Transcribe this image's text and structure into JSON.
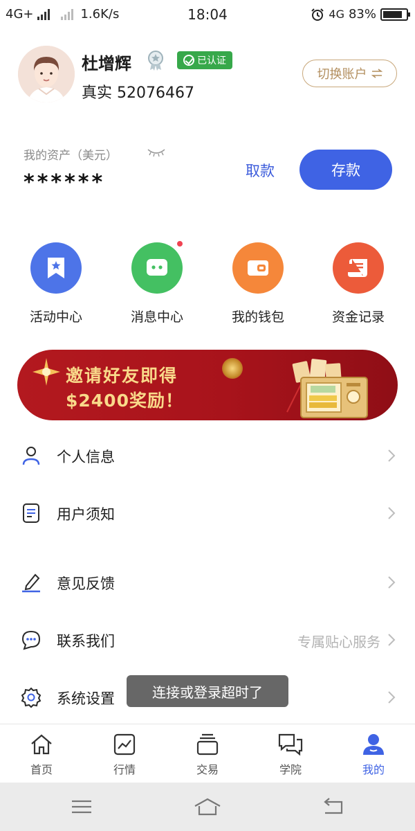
{
  "status_bar": {
    "network_left": "4G+",
    "speed": "1.6K/s",
    "time": "18:04",
    "network_right": "4G",
    "battery_percent": "83%",
    "battery_level": 0.83
  },
  "profile": {
    "name": "杜增辉",
    "verified_label": "已认证",
    "account_type": "真实",
    "account_number": "52076467",
    "switch_account_label": "切换账户",
    "switch_icon": "swap-arrows-icon",
    "avatar_icon": "user-avatar-illustration"
  },
  "assets": {
    "label": "我的资产（美元）",
    "value_masked": "******",
    "withdraw_label": "取款",
    "deposit_label": "存款"
  },
  "quick_actions": [
    {
      "label": "活动中心",
      "icon": "bookmark-star-icon",
      "color": "#4d74e8",
      "badge": false
    },
    {
      "label": "消息中心",
      "icon": "chat-bubble-icon",
      "color": "#44c062",
      "badge": true
    },
    {
      "label": "我的钱包",
      "icon": "wallet-icon",
      "color": "#f5873a",
      "badge": false
    },
    {
      "label": "资金记录",
      "icon": "scroll-record-icon",
      "color": "#ec5b3a",
      "badge": false
    }
  ],
  "banner": {
    "line1": "邀请好友即得",
    "line2": "$2400奖励！"
  },
  "menu": [
    {
      "label": "个人信息",
      "hint": "",
      "icon": "person-icon"
    },
    {
      "label": "用户须知",
      "hint": "",
      "icon": "document-icon"
    },
    {
      "label": "意见反馈",
      "hint": "",
      "icon": "pencil-icon"
    },
    {
      "label": "联系我们",
      "hint": "专属贴心服务",
      "icon": "chat-dots-icon"
    },
    {
      "label": "系统设置",
      "hint": "",
      "icon": "gear-icon"
    }
  ],
  "toast": "连接或登录超时了",
  "tabs": [
    {
      "label": "首页",
      "icon": "home-icon",
      "active": false
    },
    {
      "label": "行情",
      "icon": "chart-icon",
      "active": false
    },
    {
      "label": "交易",
      "icon": "stack-icon",
      "active": false
    },
    {
      "label": "学院",
      "icon": "chat-bubbles-icon",
      "active": false
    },
    {
      "label": "我的",
      "icon": "user-icon",
      "active": true
    }
  ],
  "colors": {
    "primary": "#3f63e4",
    "verified_green": "#37a84a",
    "gold_outline": "#c8a77a",
    "banner_red": "#b3191f",
    "banner_text": "#f9d98a"
  }
}
